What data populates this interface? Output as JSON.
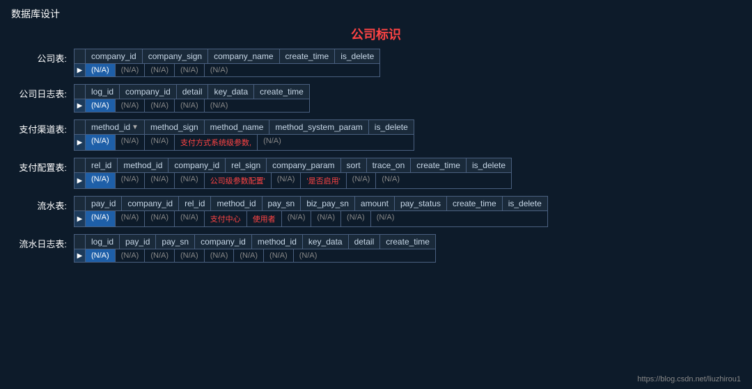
{
  "page": {
    "title": "数据库设计",
    "center_title": "公司标识",
    "footer_url": "https://blog.csdn.net/liuzhirou1"
  },
  "tables": [
    {
      "label": "公司表:",
      "columns": [
        "company_id",
        "company_sign",
        "company_name",
        "create_time",
        "is_delete"
      ],
      "data": [
        "(N/A)",
        "(N/A)",
        "(N/A)",
        "(N/A)",
        "(N/A)"
      ],
      "highlight_col": 0,
      "red_cols": []
    },
    {
      "label": "公司日志表:",
      "columns": [
        "log_id",
        "company_id",
        "detail",
        "key_data",
        "create_time"
      ],
      "data": [
        "(N/A)",
        "(N/A)",
        "(N/A)",
        "(N/A)",
        "(N/A)"
      ],
      "highlight_col": 0,
      "red_cols": []
    },
    {
      "label": "支付渠道表:",
      "columns": [
        "method_id",
        "method_sign",
        "method_name",
        "method_system_param",
        "is_delete"
      ],
      "data": [
        "(N/A)",
        "(N/A)",
        "(N/A)",
        "支付方式系统级参数,",
        "(N/A)"
      ],
      "highlight_col": 0,
      "red_cols": [
        3
      ],
      "sort_col": 0
    },
    {
      "label": "支付配置表:",
      "columns": [
        "rel_id",
        "method_id",
        "company_id",
        "rel_sign",
        "company_param",
        "sort",
        "trace_on",
        "create_time",
        "is_delete"
      ],
      "data": [
        "(N/A)",
        "(N/A)",
        "(N/A)",
        "(N/A)",
        "公司级参数配置'",
        "(N/A)",
        "'是否启用'",
        "(N/A)",
        "(N/A)"
      ],
      "highlight_col": 0,
      "red_cols": [
        4,
        6
      ]
    },
    {
      "label": "流水表:",
      "columns": [
        "pay_id",
        "company_id",
        "rel_id",
        "method_id",
        "pay_sn",
        "biz_pay_sn",
        "amount",
        "pay_status",
        "create_time",
        "is_delete"
      ],
      "data": [
        "(N/A)",
        "(N/A)",
        "(N/A)",
        "(N/A)",
        "支付中心",
        "使用者",
        "(N/A)",
        "(N/A)",
        "(N/A)",
        "(N/A)"
      ],
      "highlight_col": 0,
      "red_cols": [
        4,
        5
      ]
    },
    {
      "label": "流水日志表:",
      "columns": [
        "log_id",
        "pay_id",
        "pay_sn",
        "company_id",
        "method_id",
        "key_data",
        "detail",
        "create_time"
      ],
      "data": [
        "(N/A)",
        "(N/A)",
        "(N/A)",
        "(N/A)",
        "(N/A)",
        "(N/A)",
        "(N/A)",
        "(N/A)"
      ],
      "highlight_col": 0,
      "red_cols": []
    }
  ]
}
